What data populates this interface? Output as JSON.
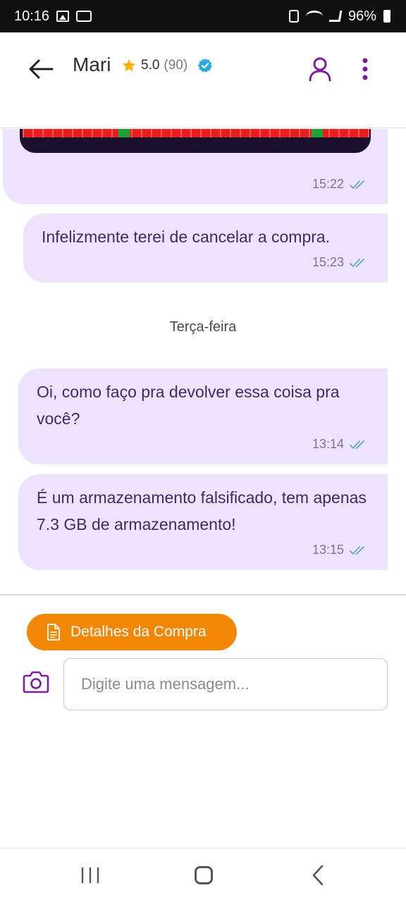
{
  "status_bar": {
    "time": "10:16",
    "battery": "96%"
  },
  "header": {
    "contact_name": "Mari",
    "rating": "5.0",
    "rating_count": "(90)"
  },
  "messages": [
    {
      "time": "15:22"
    },
    {
      "text": "Infelizmente terei de cancelar a compra.",
      "time": "15:23"
    },
    {
      "text": "Oi, como faço pra devolver essa coisa pra você?",
      "time": "13:14"
    },
    {
      "text": "É um armazenamento falsificado, tem apenas 7.3 GB de armazenamento!",
      "time": "13:15"
    }
  ],
  "day_separator": "Terça-feira",
  "composer": {
    "details_label": "Detalhes da Compra",
    "input_placeholder": "Digite uma mensagem..."
  },
  "colors": {
    "accent": "#7b1fa2",
    "bubble": "#ede3ff",
    "orange": "#f28705",
    "verified": "#2aa8e0",
    "star": "#f4b400"
  }
}
